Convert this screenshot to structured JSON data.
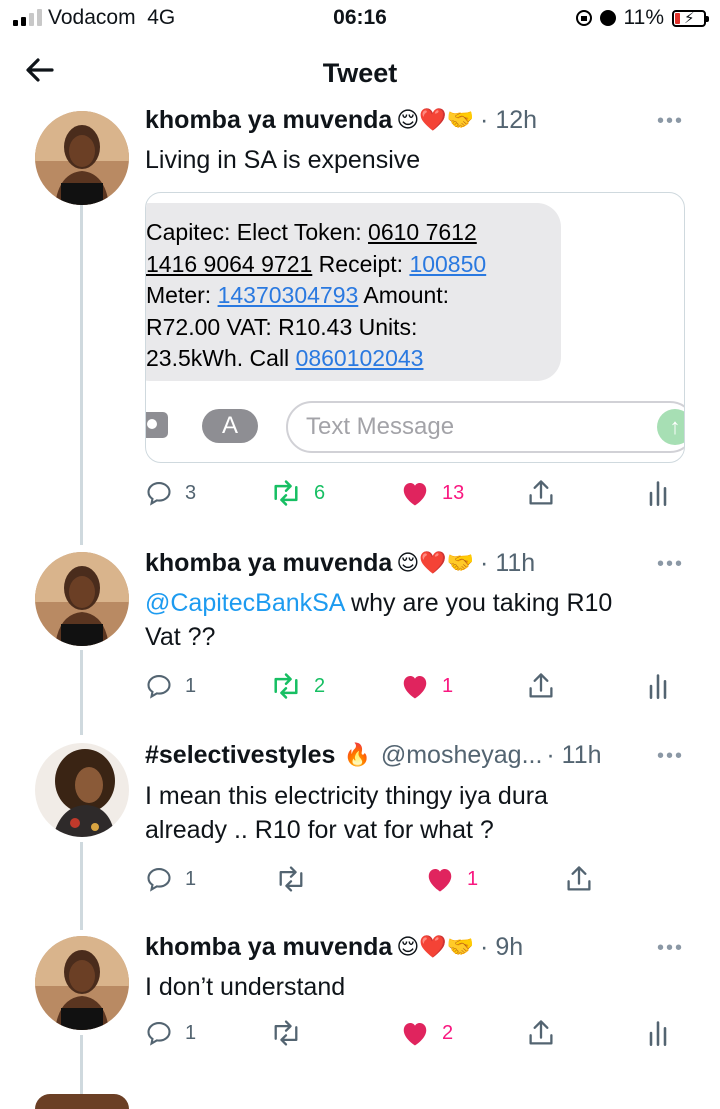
{
  "status_bar": {
    "carrier": "Vodacom",
    "network": "4G",
    "time": "06:16",
    "battery": "11%"
  },
  "header": {
    "title": "Tweet"
  },
  "tweets": [
    {
      "name": "khomba ya muvenda",
      "emoji": "😌❤️🤝",
      "time": "· 12h",
      "text": "Living in SA is expensive",
      "replies": "3",
      "retweets": "6",
      "likes": "13"
    },
    {
      "name": "khomba ya muvenda",
      "emoji": "😌❤️🤝",
      "time": "· 11h",
      "mention": "@CapitecBankSA",
      "text_line1": " why are you taking R10",
      "text_line2": "Vat ??",
      "replies": "1",
      "retweets": "2",
      "likes": "1"
    },
    {
      "name": "#selectivestyles",
      "emoji": "🔥",
      "handle": "@mosheyag...",
      "time": "· 11h",
      "text_line1": "I mean this electricity thingy iya dura",
      "text_line2": "already .. R10 for vat for what ?",
      "replies": "1",
      "retweets": "",
      "likes": "1"
    },
    {
      "name": "khomba ya muvenda",
      "emoji": "😌❤️🤝",
      "time": "· 9h",
      "text": "I don’t understand",
      "replies": "1",
      "retweets": "",
      "likes": "2"
    }
  ],
  "sms": {
    "l1a": "Capitec: Elect Token: ",
    "l1b": "0610 7612",
    "l2a": "1416 9064 9721",
    "l2b": " Receipt: ",
    "l2c": "100850",
    "l3a": "Meter: ",
    "l3b": "14370304793",
    "l3c": " Amount:",
    "l4": "R72.00 VAT: R10.43 Units:",
    "l5a": "23.5kWh. Call ",
    "l5b": "0860102043",
    "placeholder": "Text Message"
  },
  "colors": {
    "like": "#f91880",
    "retweet_active": "#17bf63",
    "link": "#1d9bf0",
    "muted": "#536471"
  }
}
